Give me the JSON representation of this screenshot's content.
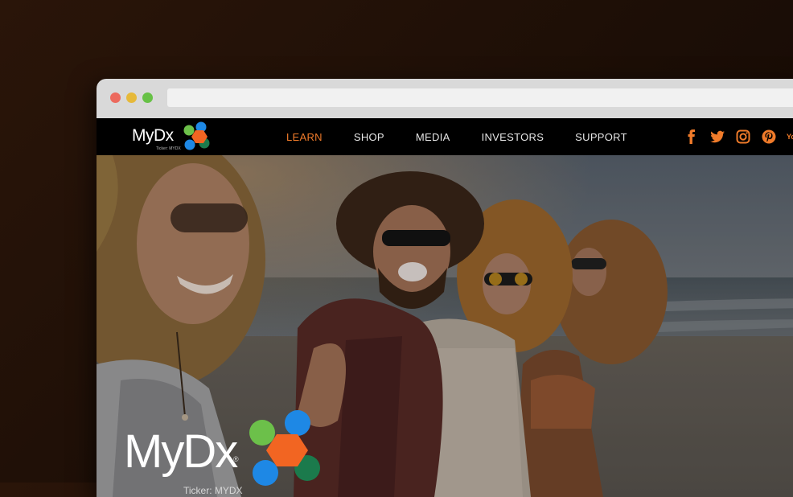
{
  "brand": {
    "name": "MyDx",
    "ticker": "Ticker: MYDX",
    "registered": "®"
  },
  "nav": {
    "items": [
      {
        "label": "LEARN",
        "active": true
      },
      {
        "label": "SHOP",
        "active": false
      },
      {
        "label": "MEDIA",
        "active": false
      },
      {
        "label": "INVESTORS",
        "active": false
      },
      {
        "label": "SUPPORT",
        "active": false
      }
    ]
  },
  "socials": [
    "facebook-icon",
    "twitter-icon",
    "instagram-icon",
    "pinterest-icon",
    "youtube-icon"
  ],
  "youtube_label": "You",
  "colors": {
    "accent": "#f07b2a",
    "logo_orange": "#f26522",
    "logo_green": "#6cc04a",
    "logo_blue": "#1e88e5",
    "logo_darkgreen": "#1b7a4c",
    "navbar": "#000000",
    "chrome": "#d9d9d9"
  }
}
